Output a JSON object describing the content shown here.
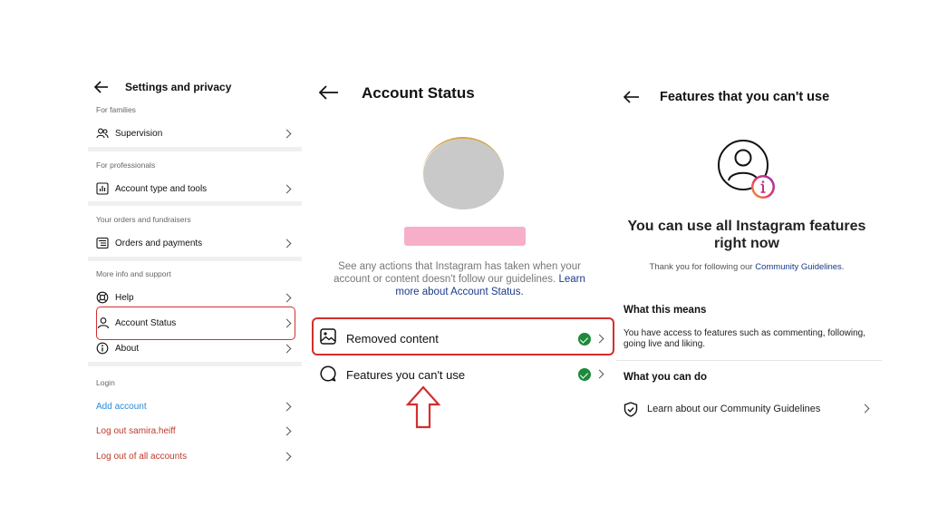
{
  "settings": {
    "title": "Settings and privacy",
    "sections": {
      "families": "For families",
      "professionals": "For professionals",
      "orders": "Your orders and fundraisers",
      "more_info": "More info and support",
      "login": "Login"
    },
    "items": {
      "supervision": "Supervision",
      "account_type": "Account type and tools",
      "orders_payments": "Orders and payments",
      "help": "Help",
      "account_status": "Account Status",
      "about": "About",
      "add_account": "Add account",
      "log_out_user": "Log out samira.heiff",
      "log_out_all": "Log out of all accounts"
    },
    "colors": {
      "link_blue": "#2a8bd6",
      "logout_red": "#c0392b",
      "highlight": "#d32f2f"
    }
  },
  "account_status": {
    "title": "Account Status",
    "description": "See any actions that Instagram has taken when your account or content doesn't follow our guidelines.",
    "learn_more": "Learn more about Account Status.",
    "rows": {
      "removed_content": "Removed content",
      "features_cant_use": "Features you can't use"
    },
    "colors": {
      "check_green": "#1d8a3a",
      "highlight": "#d32f2f",
      "avatar_gray": "#c9c9c9",
      "username_pink": "#f7aec9"
    }
  },
  "features": {
    "title": "Features that you can't use",
    "headline": "You can use all Instagram features right now",
    "thanks_prefix": "Thank you for following our",
    "thanks_link": "Community Guidelines.",
    "what_means_title": "What this means",
    "what_means_body": "You have access to features such as commenting, following, going live and liking.",
    "what_do_title": "What you can do",
    "learn_guidelines": "Learn about our Community Guidelines"
  }
}
